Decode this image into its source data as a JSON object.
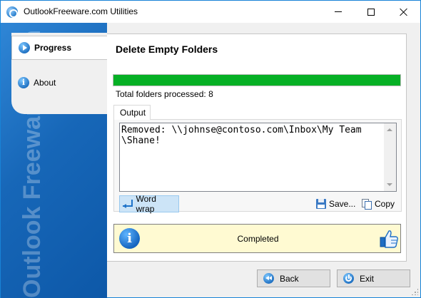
{
  "window": {
    "title": "OutlookFreeware.com Utilities"
  },
  "sidebar": {
    "brand": "Outlook Freeware .com",
    "items": [
      {
        "label": "Progress",
        "icon": "play-icon",
        "active": true
      },
      {
        "label": "About",
        "icon": "info-icon",
        "active": false
      }
    ]
  },
  "main": {
    "title": "Delete Empty Folders",
    "progress": {
      "percent": 100,
      "color": "#06b025"
    },
    "processed_text": "Total folders processed: 8",
    "tab_label": "Output",
    "output_text": "Removed: \\\\johnse@contoso.com\\Inbox\\My Team\n\\Shane!",
    "toolbar": {
      "word_wrap_label": "Word wrap",
      "save_label": "Save...",
      "copy_label": "Copy"
    },
    "status": {
      "text": "Completed",
      "background": "#fffad2"
    }
  },
  "footer": {
    "back_label": "Back",
    "exit_label": "Exit"
  }
}
